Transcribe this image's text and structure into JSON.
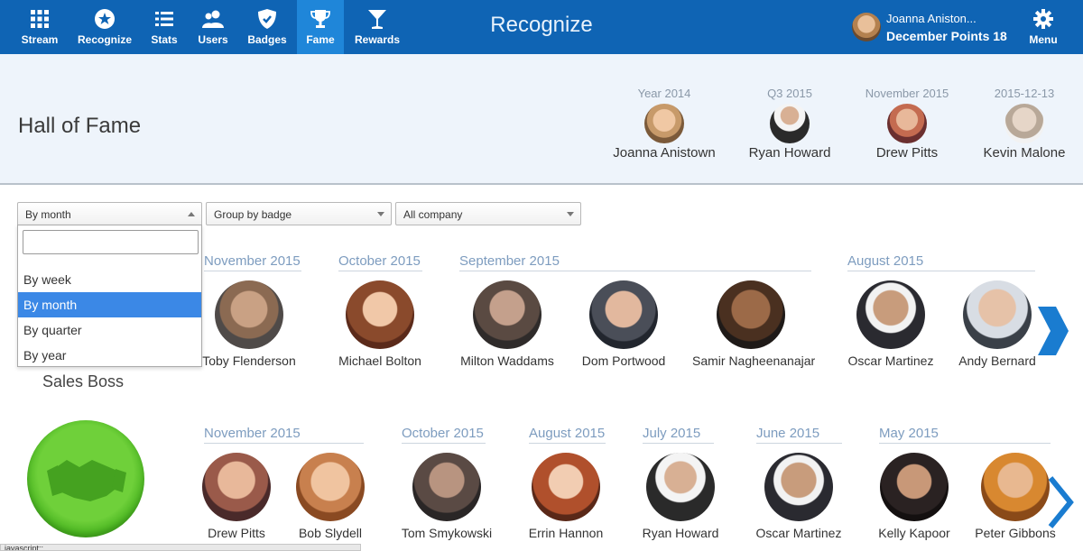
{
  "nav": {
    "items": [
      {
        "label": "Stream",
        "icon": "grid-icon"
      },
      {
        "label": "Recognize",
        "icon": "star-circle-icon"
      },
      {
        "label": "Stats",
        "icon": "list-icon"
      },
      {
        "label": "Users",
        "icon": "users-icon"
      },
      {
        "label": "Badges",
        "icon": "shield-icon"
      },
      {
        "label": "Fame",
        "icon": "trophy-icon"
      },
      {
        "label": "Rewards",
        "icon": "cocktail-icon"
      }
    ],
    "active": "Fame",
    "brand": "Recognize",
    "user_name": "Joanna Aniston...",
    "user_points": "December Points 18",
    "menu_label": "Menu",
    "accent": "#0f64b4",
    "active_bg": "#1f86d9"
  },
  "hall": {
    "title": "Hall of Fame",
    "winners": [
      {
        "period": "Year 2014",
        "name": "Joanna Anistown"
      },
      {
        "period": "Q3 2015",
        "name": "Ryan Howard"
      },
      {
        "period": "November 2015",
        "name": "Drew Pitts"
      },
      {
        "period": "2015-12-13",
        "name": "Kevin Malone"
      }
    ]
  },
  "filters": {
    "period": "By month",
    "grouping": "Group by badge",
    "scope": "All company",
    "search_value": "",
    "options": [
      "By week",
      "By month",
      "By quarter",
      "By year"
    ],
    "selected": "By month"
  },
  "rows": [
    {
      "badge": "",
      "groups": [
        {
          "label": "November 2015",
          "people": [
            "Toby Flenderson"
          ]
        },
        {
          "label": "October 2015",
          "people": [
            "Michael Bolton"
          ]
        },
        {
          "label": "September 2015",
          "people": [
            "Milton Waddams",
            "Dom Portwood",
            "Samir Nagheenanajar"
          ]
        },
        {
          "label": "August 2015",
          "people": [
            "Oscar Martinez",
            "Andy Bernard"
          ]
        }
      ]
    },
    {
      "badge": "Sales Boss",
      "groups": [
        {
          "label": "November 2015",
          "people": [
            "Drew Pitts",
            "Bob Slydell"
          ]
        },
        {
          "label": "October 2015",
          "people": [
            "Tom Smykowski"
          ]
        },
        {
          "label": "August 2015",
          "people": [
            "Errin Hannon"
          ]
        },
        {
          "label": "July 2015",
          "people": [
            "Ryan Howard"
          ]
        },
        {
          "label": "June 2015",
          "people": [
            "Oscar Martinez"
          ]
        },
        {
          "label": "May 2015",
          "people": [
            "Kelly Kapoor",
            "Peter Gibbons"
          ]
        }
      ]
    }
  ],
  "status_text": "javascript:;"
}
